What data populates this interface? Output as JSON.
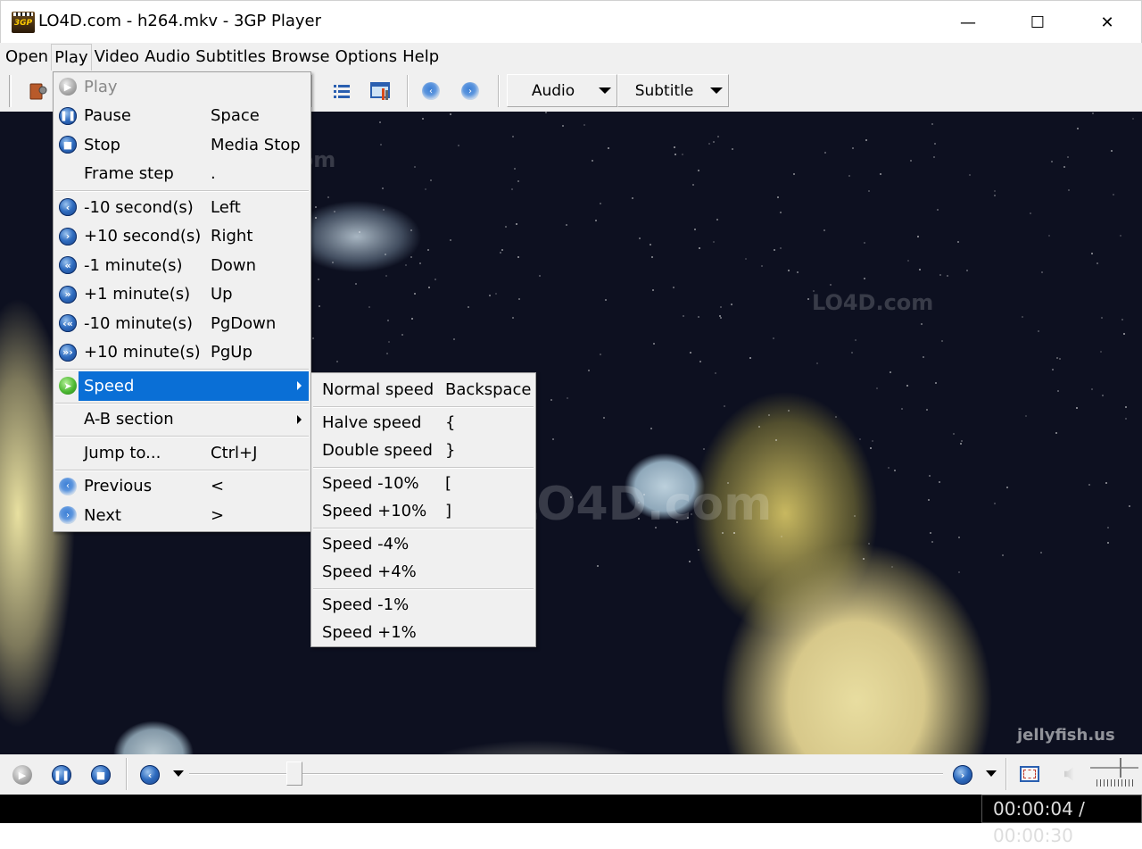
{
  "window": {
    "title": "LO4D.com - h264.mkv - 3GP Player",
    "app_icon_label": "3GP",
    "minimize": "—",
    "maximize": "☐",
    "close": "✕"
  },
  "menubar": {
    "items": [
      "Open",
      "Play",
      "Video",
      "Audio",
      "Subtitles",
      "Browse",
      "Options",
      "Help"
    ],
    "active": "Play"
  },
  "toolbar": {
    "icons": [
      "open-file-icon",
      "playlist-icon",
      "settings-icon",
      "previous-icon",
      "next-icon"
    ],
    "audio_dropdown": "Audio",
    "subtitle_dropdown": "Subtitle"
  },
  "play_menu": {
    "items": [
      {
        "label": "Play",
        "shortcut": "",
        "icon": "play-icon",
        "disabled": true
      },
      {
        "label": "Pause",
        "shortcut": "Space",
        "icon": "pause-icon"
      },
      {
        "label": "Stop",
        "shortcut": "Media Stop",
        "icon": "stop-icon"
      },
      {
        "label": "Frame step",
        "shortcut": ".",
        "icon": ""
      },
      {
        "label": "-10 second(s)",
        "shortcut": "Left",
        "icon": "back-10s-icon"
      },
      {
        "label": "+10 second(s)",
        "shortcut": "Right",
        "icon": "forward-10s-icon"
      },
      {
        "label": "-1 minute(s)",
        "shortcut": "Down",
        "icon": "back-1m-icon"
      },
      {
        "label": "+1 minute(s)",
        "shortcut": "Up",
        "icon": "forward-1m-icon"
      },
      {
        "label": "-10 minute(s)",
        "shortcut": "PgDown",
        "icon": "back-10m-icon"
      },
      {
        "label": "+10 minute(s)",
        "shortcut": "PgUp",
        "icon": "forward-10m-icon"
      },
      {
        "label": "Speed",
        "shortcut": "",
        "icon": "speed-icon",
        "highlighted": true,
        "submenu": true
      },
      {
        "label": "A-B section",
        "shortcut": "",
        "icon": "",
        "submenu": true
      },
      {
        "label": "Jump to...",
        "shortcut": "Ctrl+J",
        "icon": ""
      },
      {
        "label": "Previous",
        "shortcut": "<",
        "icon": "previous-icon"
      },
      {
        "label": "Next",
        "shortcut": ">",
        "icon": "next-icon"
      }
    ]
  },
  "speed_menu": {
    "items": [
      {
        "label": "Normal speed",
        "shortcut": "Backspace"
      },
      {
        "label": "Halve speed",
        "shortcut": "{"
      },
      {
        "label": "Double speed",
        "shortcut": "}"
      },
      {
        "label": "Speed -10%",
        "shortcut": "["
      },
      {
        "label": "Speed +10%",
        "shortcut": "]"
      },
      {
        "label": "Speed -4%",
        "shortcut": ""
      },
      {
        "label": "Speed +4%",
        "shortcut": ""
      },
      {
        "label": "Speed -1%",
        "shortcut": ""
      },
      {
        "label": "Speed +1%",
        "shortcut": ""
      }
    ]
  },
  "video": {
    "watermarks": [
      "LO4D.com",
      "LO4D.com",
      "LO4D.com"
    ],
    "corner_text": "jellyfish.us"
  },
  "controls": {
    "seek_position": 0.14,
    "volume_level": 0.65
  },
  "status": {
    "time": "00:00:04 / 00:00:30"
  },
  "colors": {
    "highlight": "#0a6fd6",
    "chrome": "#f0f0f0"
  }
}
